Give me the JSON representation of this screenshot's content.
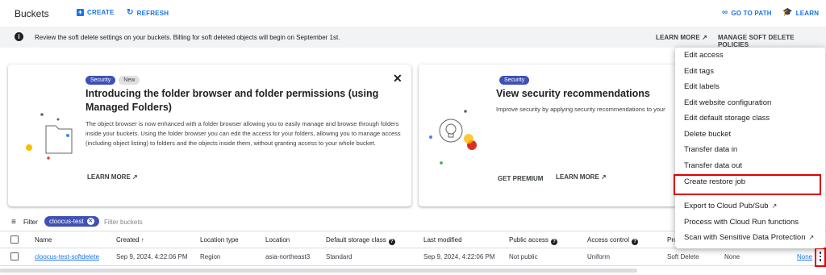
{
  "header": {
    "title": "Buckets",
    "create_label": "CREATE",
    "refresh_label": "REFRESH",
    "go_to_path_label": "GO TO PATH",
    "learn_label": "LEARN"
  },
  "banner": {
    "message": "Review the soft delete settings on your buckets. Billing for soft deleted objects will begin on September 1st.",
    "learn_more_label": "LEARN MORE",
    "manage_label": "MANAGE SOFT DELETE POLICIES"
  },
  "card_folders": {
    "chip_security": "Security",
    "chip_new": "New",
    "title": "Introducing the folder browser and folder permissions (using Managed Folders)",
    "body": "The object browser is now enhanced with a folder browser allowing you to easily manage and browse through folders inside your buckets. Using the folder browser you can edit the access for your folders, allowing you to manage access (including object listing) to folders and the objects inside them, without granting access to your whole bucket.",
    "learn_more_label": "LEARN MORE",
    "close_label": "✕"
  },
  "card_security": {
    "chip_security": "Security",
    "title": "View security recommendations",
    "body": "Improve security by applying security recommendations to your",
    "get_premium_label": "GET PREMIUM",
    "learn_more_label": "LEARN MORE"
  },
  "filter": {
    "label": "Filter",
    "chip_value": "cloocus-test",
    "placeholder": "Filter buckets"
  },
  "table": {
    "columns": {
      "name": "Name",
      "created": "Created",
      "location_type": "Location type",
      "location": "Location",
      "storage_class": "Default storage class",
      "last_modified": "Last modified",
      "public_access": "Public access",
      "access_control": "Access control",
      "pro_partial": "Pro"
    },
    "rows": [
      {
        "name": "cloocus-test-softdelete",
        "created": "Sep 9, 2024, 4:22:06 PM",
        "location_type": "Region",
        "location": "asia-northeast3",
        "storage_class": "Standard",
        "last_modified": "Sep 9, 2024, 4:22:06 PM",
        "public_access": "Not public",
        "access_control": "Uniform",
        "protection": "Soft Delete",
        "col_none": "None",
        "col_none_link": "None"
      }
    ]
  },
  "context_menu": {
    "items": [
      {
        "label": "Edit access"
      },
      {
        "label": "Edit tags"
      },
      {
        "label": "Edit labels"
      },
      {
        "label": "Edit website configuration"
      },
      {
        "label": "Edit default storage class"
      },
      {
        "label": "Delete bucket"
      },
      {
        "label": "Transfer data in"
      },
      {
        "label": "Transfer data out"
      },
      {
        "label": "Create restore job"
      },
      {
        "label": "Export to Cloud Pub/Sub"
      },
      {
        "label": "Process with Cloud Run functions"
      },
      {
        "label": "Scan with Sensitive Data Protection"
      }
    ],
    "highlighted_item": "Create restore job"
  },
  "colors": {
    "accent": "#1a73e8",
    "chip": "#3f51b5",
    "highlight": "#e00000"
  }
}
